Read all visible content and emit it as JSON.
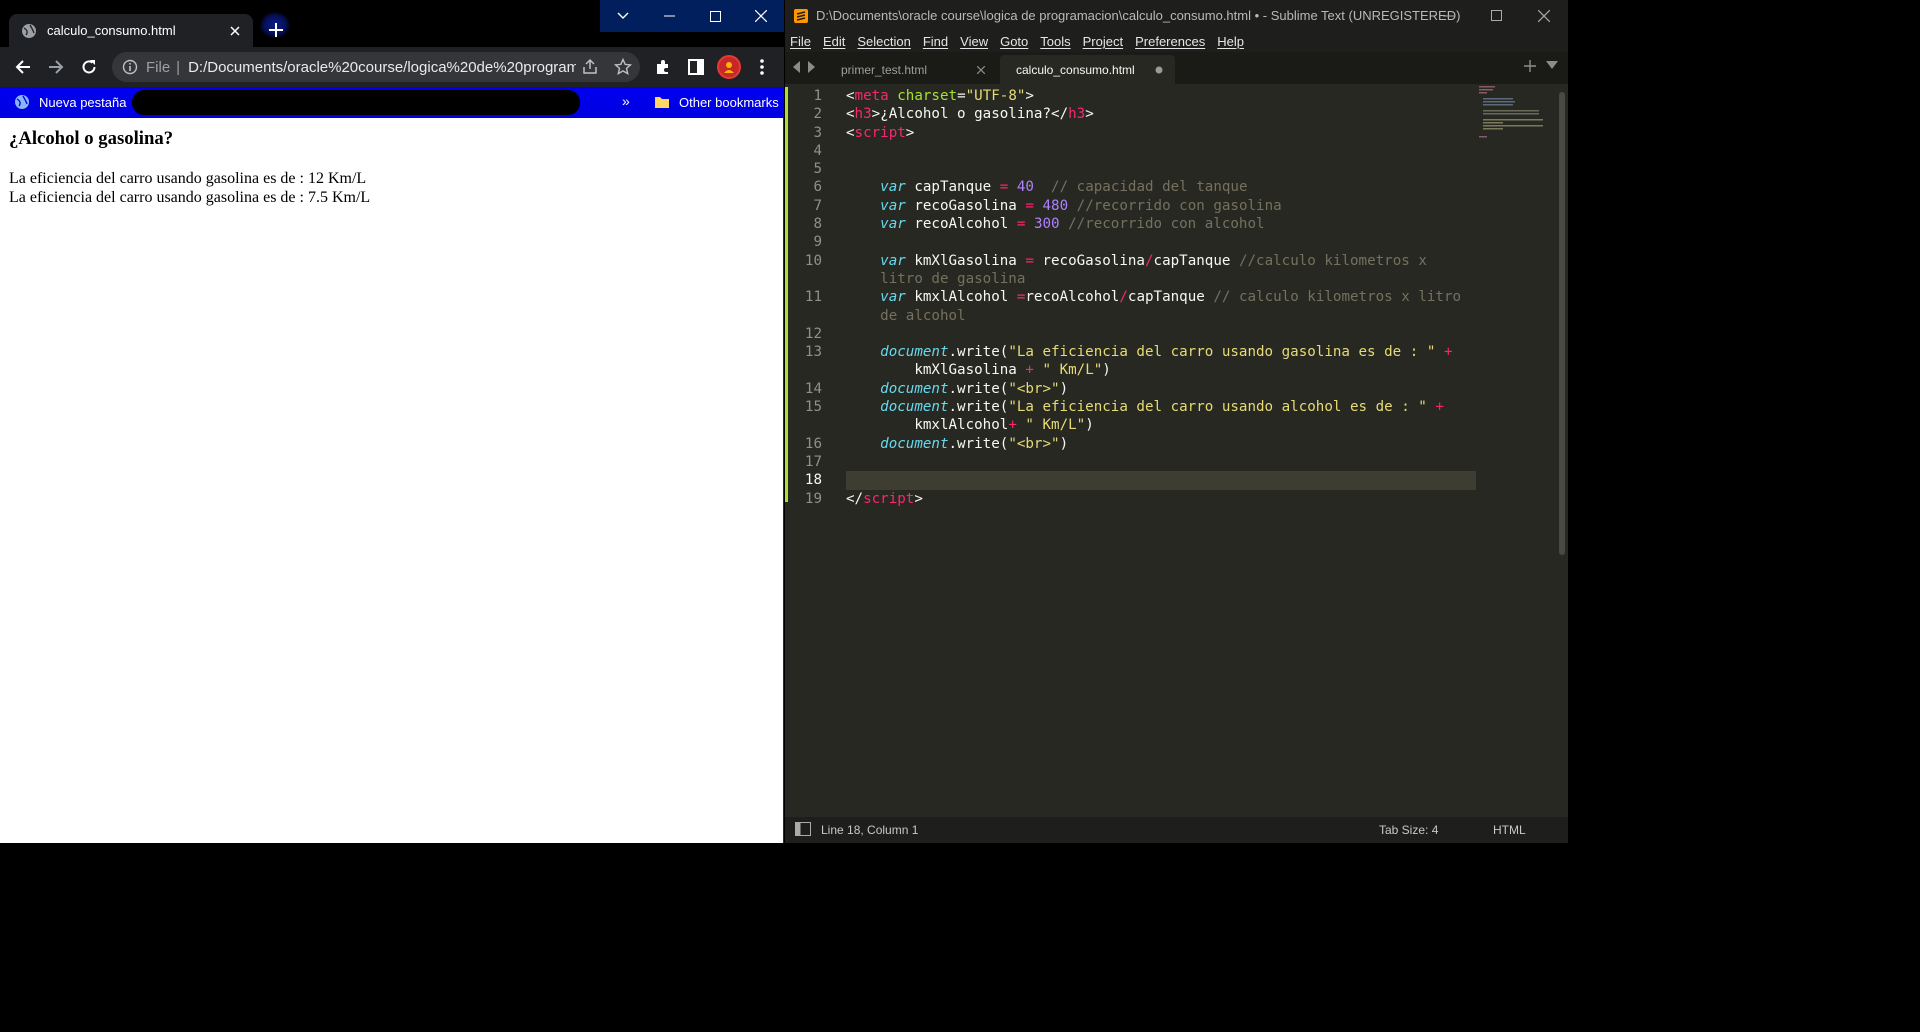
{
  "chrome": {
    "tab_title": "calculo_consumo.html",
    "url_scheme": "File",
    "url": "D:/Documents/oracle%20course/logica%20de%20program...",
    "bookmarks": {
      "nueva_pestana": "Nueva pestaña",
      "more": "»",
      "other": "Other bookmarks"
    },
    "page": {
      "heading": "¿Alcohol o gasolina?",
      "lines": [
        "La eficiencia del carro usando gasolina es de : 12 Km/L",
        "La eficiencia del carro usando gasolina es de : 7.5 Km/L"
      ]
    }
  },
  "sublime": {
    "window_title": "D:\\Documents\\oracle course\\logica de programacion\\calculo_consumo.html • - Sublime Text (UNREGISTERED)",
    "menu": [
      "File",
      "Edit",
      "Selection",
      "Find",
      "View",
      "Goto",
      "Tools",
      "Project",
      "Preferences",
      "Help"
    ],
    "tabs": [
      {
        "label": "primer_test.html",
        "active": false
      },
      {
        "label": "calculo_consumo.html",
        "active": true
      }
    ],
    "code": {
      "line_numbers": [
        "1",
        "2",
        "3",
        "4",
        "5",
        "6",
        "7",
        "8",
        "9",
        "10",
        "11",
        "12",
        "13",
        "14",
        "15",
        "16",
        "17",
        "18",
        "19"
      ],
      "meta_open": "<",
      "meta_tag": "meta",
      "meta_attr": "charset",
      "meta_eq": "=",
      "meta_val": "\"UTF-8\"",
      "meta_close": ">",
      "h3_open": "<",
      "h3_tag": "h3",
      "h3_gt": ">",
      "h3_text": "¿Alcohol o gasolina?",
      "h3_end_lt": "</",
      "h3_end_tag": "h3",
      "h3_end_gt": ">",
      "script_lt": "<",
      "script_tag": "script",
      "script_gt": ">",
      "l6_var": "var",
      "l6_name": " capTanque ",
      "l6_eq": "=",
      "l6_num": "40",
      "l6_comment": "  // capacidad del tanque",
      "l7_var": "var",
      "l7_name": " recoGasolina ",
      "l7_eq": "=",
      "l7_num": "480",
      "l7_comment": " //recorrido con gasolina",
      "l8_var": "var",
      "l8_name": " recoAlcohol ",
      "l8_eq": "=",
      "l8_num": "300",
      "l8_comment": " //recorrido con alcohol",
      "l10_var": "var",
      "l10_name": " kmXlGasolina ",
      "l10_eq": "=",
      "l10_a": " recoGasolina",
      "l10_div": "/",
      "l10_b": "capTanque ",
      "l10_comment1": "//calculo kilometros x",
      "l10_comment2": "litro de gasolina",
      "l11_var": "var",
      "l11_name": " kmxlAlcohol ",
      "l11_eq": "=",
      "l11_a": "recoAlcohol",
      "l11_div": "/",
      "l11_b": "capTanque ",
      "l11_comment1": "// calculo kilometros x litro",
      "l11_comment2": "de alcohol",
      "doc": "document",
      "write": ".write(",
      "close_paren": ")",
      "l13_str": "\"La eficiencia del carro usando gasolina es de : \"",
      "plus": "+",
      "l13_var": "kmXlGasolina ",
      "km_str": "\" Km/L\"",
      "br_str": "\"<br>\"",
      "l15_str": "\"La eficiencia del carro usando alcohol es de : \"",
      "l15_var": "kmxlAlcohol",
      "script_end_lt": "</",
      "script_end_tag": "script",
      "script_end_gt": ">"
    },
    "status": {
      "position": "Line 18, Column 1",
      "tab_size": "Tab Size: 4",
      "syntax": "HTML"
    }
  },
  "colors": {
    "bookmarks_bar": "#0000f0",
    "editor_bg": "#272822",
    "modified_bar": "#a6e22e",
    "tag": "#f92672",
    "string": "#e6db74",
    "keyword": "#66d9ef",
    "number": "#ae81ff",
    "comment": "#75715e"
  },
  "icons": [
    "globe-icon",
    "close-icon",
    "plus-icon",
    "chevron-down-icon",
    "minimize-icon",
    "maximize-icon",
    "back-arrow-icon",
    "forward-arrow-icon",
    "reload-icon",
    "info-icon",
    "share-icon",
    "star-icon",
    "extensions-icon",
    "side-panel-icon",
    "profile-avatar",
    "kebab-menu-icon",
    "folder-icon",
    "sublime-logo-icon"
  ]
}
